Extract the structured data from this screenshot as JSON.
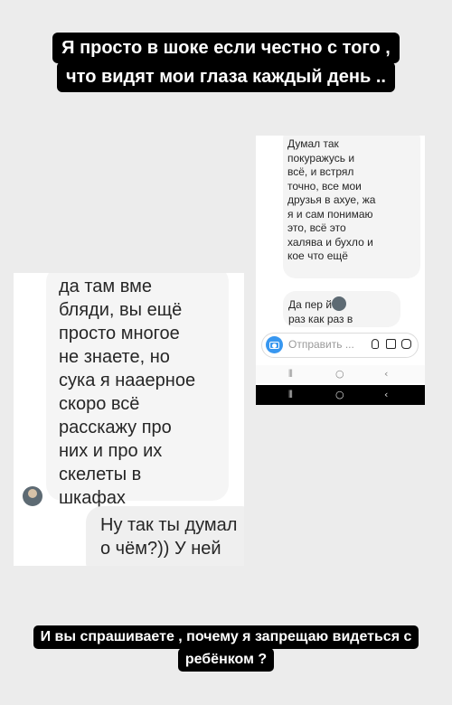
{
  "story": {
    "headline": {
      "line1": "Я просто в шоке если честно с того ,",
      "line2": "что видят мои глаза каждый день .."
    },
    "caption": {
      "line1": "И вы спрашиваете , почему я запрещаю видеться с",
      "line2": "ребёнком ?"
    }
  },
  "screenshot_left": {
    "incoming_message": "да там вме\nбляди, вы ещё\nпросто многое\nне знаете, но\nсука я нааерное\nскоро всё\nрасскажу про\nних и про их\nскелеты в\nшкафах",
    "outgoing_message": "Ну так ты думал\nо чём?)) У ней"
  },
  "screenshot_right": {
    "message_1": "Думал так\nпокуражусь и\nвсё, и встрял\nточно, все мои\nдрузья в ахуе, жа\nя и сам понимаю\nэто, всё это\nхалява и бухло и\nкое что ещё",
    "message_2": "Да пер   й\nраз как раз в",
    "composer_placeholder": "Отправить ...",
    "nav": {
      "recents": "⦀",
      "home": "○",
      "back": "‹"
    }
  },
  "colors": {
    "background": "#ececec",
    "label_bg": "#000000",
    "accent": "#3897f0"
  }
}
